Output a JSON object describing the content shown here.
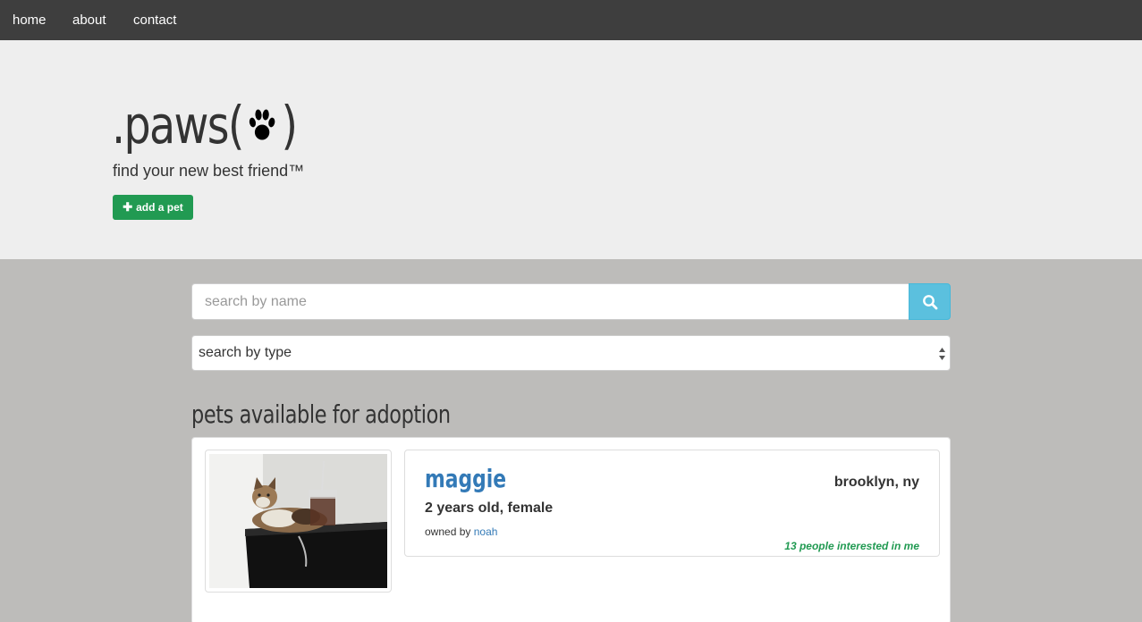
{
  "nav": {
    "items": [
      {
        "label": "home"
      },
      {
        "label": "about"
      },
      {
        "label": "contact"
      }
    ]
  },
  "hero": {
    "brand_prefix": ".paws(",
    "brand_suffix": ")",
    "brand_icon": "paw-icon",
    "tagline": "find your new best friend™",
    "add_button_icon": "plus-icon",
    "add_button_label": "add a pet"
  },
  "search": {
    "name_placeholder": "search by name",
    "name_value": "",
    "button_icon": "search-icon",
    "type_selected": "search by type"
  },
  "listing": {
    "title": "pets available for adoption",
    "pets": [
      {
        "name": "maggie",
        "location": "brooklyn, ny",
        "age_sex": "2 years old, female",
        "owner_prefix": "owned by",
        "owner_name": "noah",
        "interest": "13 people interested in me"
      }
    ]
  },
  "colors": {
    "navbar": "#3e3e3e",
    "hero_bg": "#eeeeee",
    "page_bg": "#bdbcba",
    "success": "#219a52",
    "info": "#5bc0de",
    "link": "#337ab7"
  }
}
